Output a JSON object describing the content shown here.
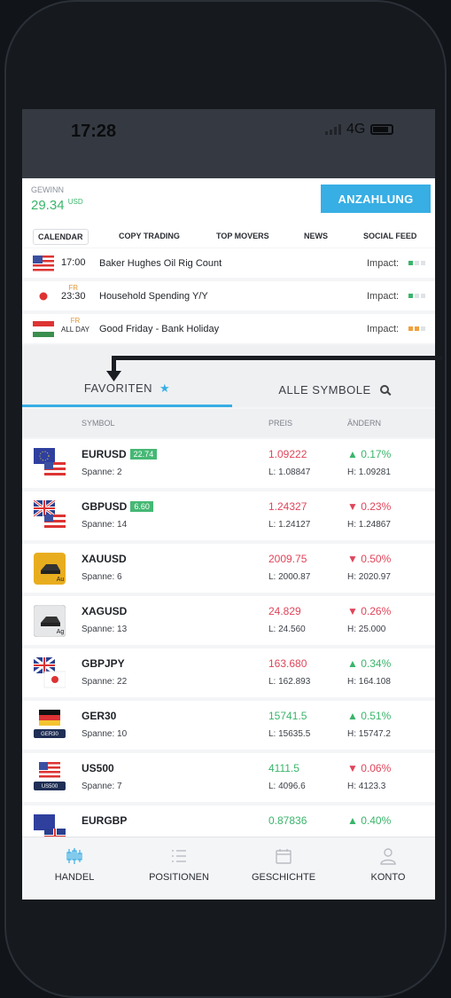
{
  "status": {
    "time": "17:28",
    "network": "4G"
  },
  "account": {
    "gewinn_label": "GEWINN",
    "gewinn_value": "29.34",
    "currency": "USD",
    "deposit_label": "ANZAHLUNG"
  },
  "feed_tabs": [
    "CALENDAR",
    "COPY TRADING",
    "TOP MOVERS",
    "NEWS",
    "SOCIAL FEED"
  ],
  "calendar": [
    {
      "day": "",
      "time": "17:00",
      "title": "Baker Hughes Oil Rig Count",
      "impact_label": "Impact:",
      "flag": "us-flag-icon",
      "impact_color": "#3ab56b",
      "impact_level": 1
    },
    {
      "day": "FR",
      "time": "23:30",
      "title": "Household Spending Y/Y",
      "impact_label": "Impact:",
      "flag": "japan-flag-icon",
      "impact_color": "#3ab56b",
      "impact_level": 1
    },
    {
      "day": "FR",
      "time": "ALL DAY",
      "title": "Good Friday - Bank Holiday",
      "impact_label": "Impact:",
      "flag": "hungary-flag-icon",
      "impact_color": "#f0a13c",
      "impact_level": 2
    }
  ],
  "symbol_tabs": {
    "favorites": "FAVORITEN",
    "all_symbols": "ALLE SYMBOLE"
  },
  "columns": {
    "symbol": "SYMBOL",
    "price": "PREIS",
    "change": "ÄNDERN"
  },
  "symbols": [
    {
      "name": "EURUSD",
      "badge": "22.74",
      "spread": "Spanne: 2",
      "price": "1.09222",
      "low": "L: 1.08847",
      "change": "0.17%",
      "direction": "up",
      "high": "H: 1.09281",
      "price_dir": "down",
      "icon": "eu-us-flag-icon"
    },
    {
      "name": "GBPUSD",
      "badge": "6.60",
      "spread": "Spanne: 14",
      "price": "1.24327",
      "low": "L: 1.24127",
      "change": "0.23%",
      "direction": "down",
      "high": "H: 1.24867",
      "price_dir": "down",
      "icon": "uk-us-flag-icon"
    },
    {
      "name": "XAUUSD",
      "badge": "",
      "spread": "Spanne: 6",
      "price": "2009.75",
      "low": "L: 2000.87",
      "change": "0.50%",
      "direction": "down",
      "high": "H: 2020.97",
      "price_dir": "down",
      "icon": "gold-bar-icon",
      "icon_text": "Au"
    },
    {
      "name": "XAGUSD",
      "badge": "",
      "spread": "Spanne: 13",
      "price": "24.829",
      "low": "L: 24.560",
      "change": "0.26%",
      "direction": "down",
      "high": "H: 25.000",
      "price_dir": "down",
      "icon": "silver-bar-icon",
      "icon_text": "Ag"
    },
    {
      "name": "GBPJPY",
      "badge": "",
      "spread": "Spanne: 22",
      "price": "163.680",
      "low": "L: 162.893",
      "change": "0.34%",
      "direction": "up",
      "high": "H: 164.108",
      "price_dir": "down",
      "icon": "uk-japan-flag-icon"
    },
    {
      "name": "GER30",
      "badge": "",
      "spread": "Spanne: 10",
      "price": "15741.5",
      "low": "L: 15635.5",
      "change": "0.51%",
      "direction": "up",
      "high": "H: 15747.2",
      "price_dir": "up",
      "icon": "germany-flag-icon",
      "icon_text": "GER30"
    },
    {
      "name": "US500",
      "badge": "",
      "spread": "Spanne: 7",
      "price": "4111.5",
      "low": "L: 4096.6",
      "change": "0.06%",
      "direction": "down",
      "high": "H: 4123.3",
      "price_dir": "up",
      "icon": "us-flag-icon",
      "icon_text": "US500"
    },
    {
      "name": "EURGBP",
      "badge": "",
      "spread": "",
      "price": "0.87836",
      "low": "",
      "change": "0.40%",
      "direction": "up",
      "high": "",
      "price_dir": "up",
      "icon": "eu-uk-flag-icon"
    }
  ],
  "bottom_nav": [
    {
      "label": "HANDEL",
      "icon": "candlestick-icon",
      "active": true
    },
    {
      "label": "POSITIONEN",
      "icon": "list-icon",
      "active": false
    },
    {
      "label": "GESCHICHTE",
      "icon": "calendar-icon",
      "active": false
    },
    {
      "label": "KONTO",
      "icon": "person-icon",
      "active": false
    }
  ],
  "colors": {
    "accent": "#37aee4",
    "up": "#3ab56b",
    "down": "#e0455a"
  }
}
